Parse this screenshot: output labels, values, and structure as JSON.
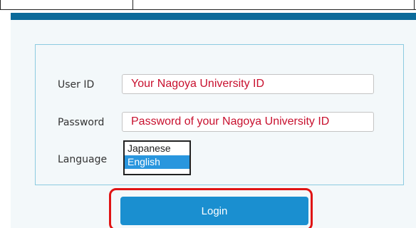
{
  "form": {
    "user_id": {
      "label": "User ID",
      "placeholder": "Your Nagoya University ID",
      "value": ""
    },
    "password": {
      "label": "Password",
      "placeholder": "Password of your Nagoya University ID",
      "value": ""
    },
    "language": {
      "label": "Language",
      "options": [
        "Japanese",
        "English"
      ],
      "selected": "English"
    },
    "login_label": "Login"
  },
  "colors": {
    "header_bar": "#0b6a9a",
    "login_button": "#1a8fd0",
    "placeholder_text": "#c8102e",
    "highlight_outline": "#e01414",
    "selected_option": "#2996de"
  }
}
